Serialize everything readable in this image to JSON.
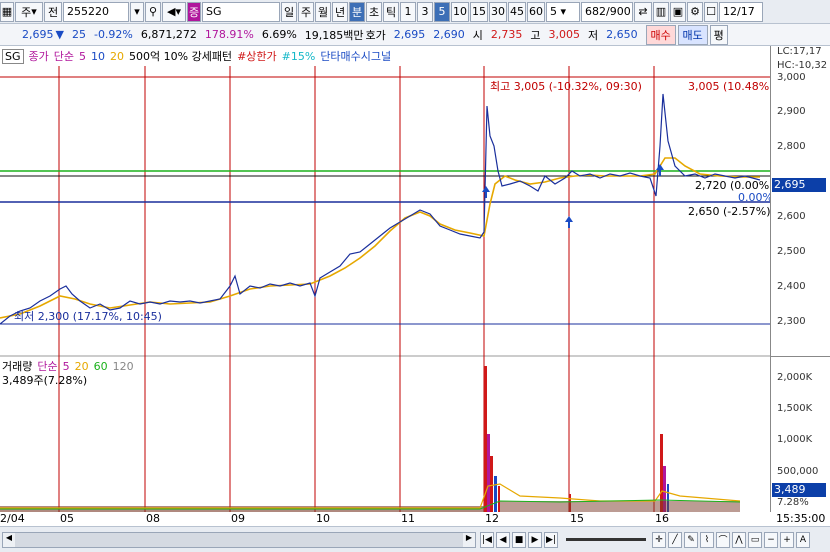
{
  "toolbar": {
    "market": "주",
    "code_prefix": "전",
    "code": "255220",
    "name": "SG",
    "periods": [
      "일",
      "주",
      "월",
      "년",
      "분",
      "초",
      "틱"
    ],
    "selected_period": "분",
    "minutes": [
      "1",
      "3",
      "5",
      "10",
      "15",
      "30",
      "45",
      "60"
    ],
    "selected_minute": "5",
    "custom_value": "5",
    "count": "682/900",
    "date": "12/17"
  },
  "infobar": {
    "price": "2,695",
    "change": "25",
    "change_pct": "-0.92%",
    "volume": "6,871,272",
    "volume_pct": "178.91%",
    "turnover_pct": "6.69%",
    "amount": "19,185백만",
    "hoga_label": "호가",
    "ask": "2,695",
    "bid": "2,690",
    "open_label": "시",
    "open": "2,735",
    "high_label": "고",
    "high": "3,005",
    "low_label": "저",
    "low": "2,650",
    "buy_button": "매수",
    "sell_button": "매도",
    "extra_button": "평"
  },
  "legend": {
    "close_label": "종가",
    "ma_label": "단순",
    "ma5": "5",
    "ma10": "10",
    "ma20": "20",
    "signal1": "500억 10% 강세패턴",
    "signal2": "#상한가",
    "signal3": "#15%",
    "signal4": "단타매수시그널",
    "sg_tag": "SG",
    "lc": "LC:17,17",
    "hc": "HC:-10,32"
  },
  "annotations": {
    "high_note": "최고 3,005 (-10.32%, 09:30)",
    "high_right": "3,005 (10.48%)",
    "mid_note": "2,720 (0.00%)",
    "zero_note": "0.00%",
    "low_right": "2,650 (-2.57%)",
    "low_note": "최저 2,300 (17.17%, 10:45)",
    "current_price": "2,695"
  },
  "price_axis": [
    "3,000",
    "2,900",
    "2,800",
    "2,700",
    "2,600",
    "2,500",
    "2,400",
    "2,300"
  ],
  "volume_legend": {
    "label": "거래량",
    "ma_label": "단순",
    "ma5": "5",
    "ma20": "20",
    "ma60": "60",
    "ma120": "120",
    "current": "3,489주(7.28%)"
  },
  "volume_axis": [
    "2,000K",
    "1,500K",
    "1,000K",
    "500,000"
  ],
  "volume_badge": "3,489",
  "volume_pct_badge": "7.28%",
  "dates": [
    "2/04",
    "05",
    "08",
    "09",
    "10",
    "11",
    "12",
    "15",
    "16"
  ],
  "time_label": "15:35:00",
  "colors": {
    "price_line": "#1a2f9c",
    "ma5": "#d01818",
    "ma20": "#e6a800",
    "up": "#d01818",
    "down": "#1a4bc4",
    "badge": "#0c3fa8"
  }
}
